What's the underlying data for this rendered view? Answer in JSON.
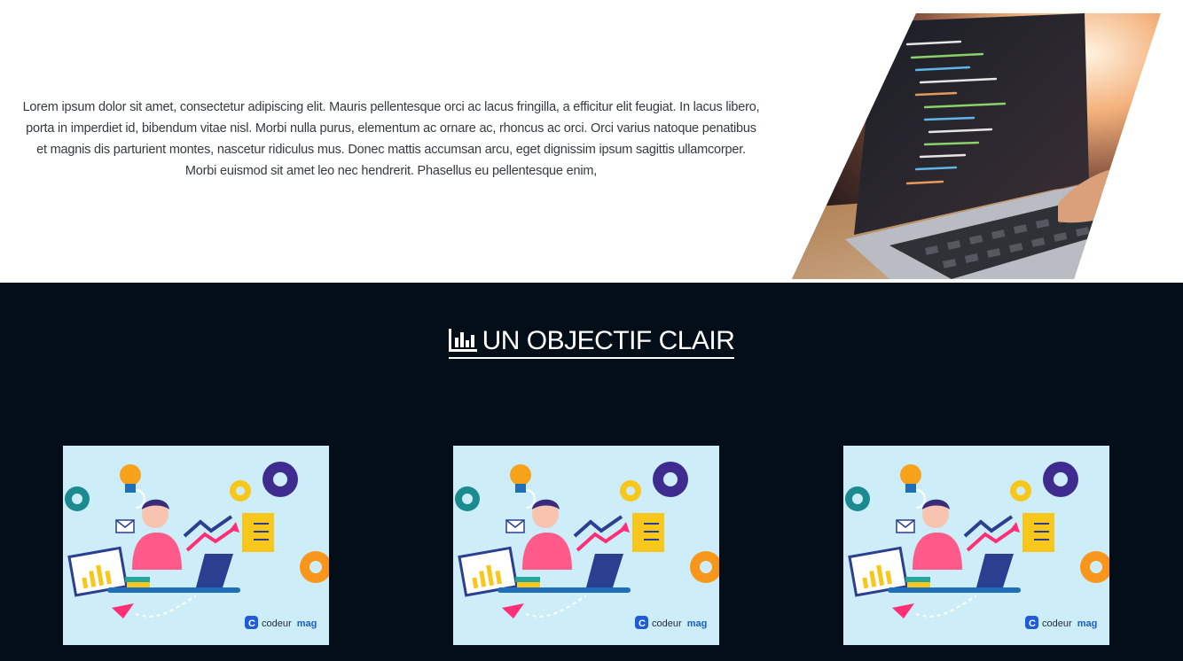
{
  "intro": {
    "text": "Lorem ipsum dolor sit amet, consectetur adipiscing elit. Mauris pellentesque orci ac lacus fringilla, a efficitur elit feugiat. In lacus libero, porta in imperdiet id, bibendum vitae nisl. Morbi nulla purus, elementum ac ornare ac, rhoncus ac orci. Orci varius natoque penatibus et magnis dis parturient montes, nascetur ridiculus mus. Donec mattis accumsan arcu, eget dignissim ipsum sagittis ullamcorper. Morbi euismod sit amet leo nec hendrerit. Phasellus eu pellentesque enim,"
  },
  "hero_image": {
    "icon": "laptop-code-photo"
  },
  "section": {
    "heading": "UN OBJECTIF CLAIR",
    "heading_icon": "bar-chart-icon"
  },
  "cards": [
    {
      "brand_main": "codeur",
      "brand_accent": "mag"
    },
    {
      "brand_main": "codeur",
      "brand_accent": "mag"
    },
    {
      "brand_main": "codeur",
      "brand_accent": "mag"
    }
  ],
  "colors": {
    "dark_bg": "#030e18",
    "card_bg": "#cdeef9",
    "brand_blue": "#1e5bd8",
    "accent_pink": "#ff2f77"
  }
}
